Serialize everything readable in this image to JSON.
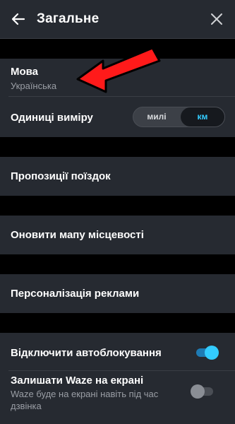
{
  "header": {
    "title": "Загальне"
  },
  "language": {
    "label": "Мова",
    "value": "Українська"
  },
  "units": {
    "label": "Одиниці виміру",
    "option_miles": "милі",
    "option_km": "км",
    "selected": "км"
  },
  "trip_suggestions": {
    "label": "Пропозиції поїздок"
  },
  "update_map": {
    "label": "Оновити мапу місцевості"
  },
  "ad_personalization": {
    "label": "Персоналізація реклами"
  },
  "disable_autolock": {
    "label": "Відключити автоблокування",
    "enabled": true
  },
  "keep_on_screen": {
    "label": "Залишати Waze на екрані",
    "description_line1": "Waze буде на екрані навіть під час",
    "description_line2": "дзвінка",
    "enabled": false
  },
  "colors": {
    "background": "#000000",
    "cell": "#262a31",
    "accent": "#33ccff",
    "annotation_arrow": "#ff1a1a"
  }
}
